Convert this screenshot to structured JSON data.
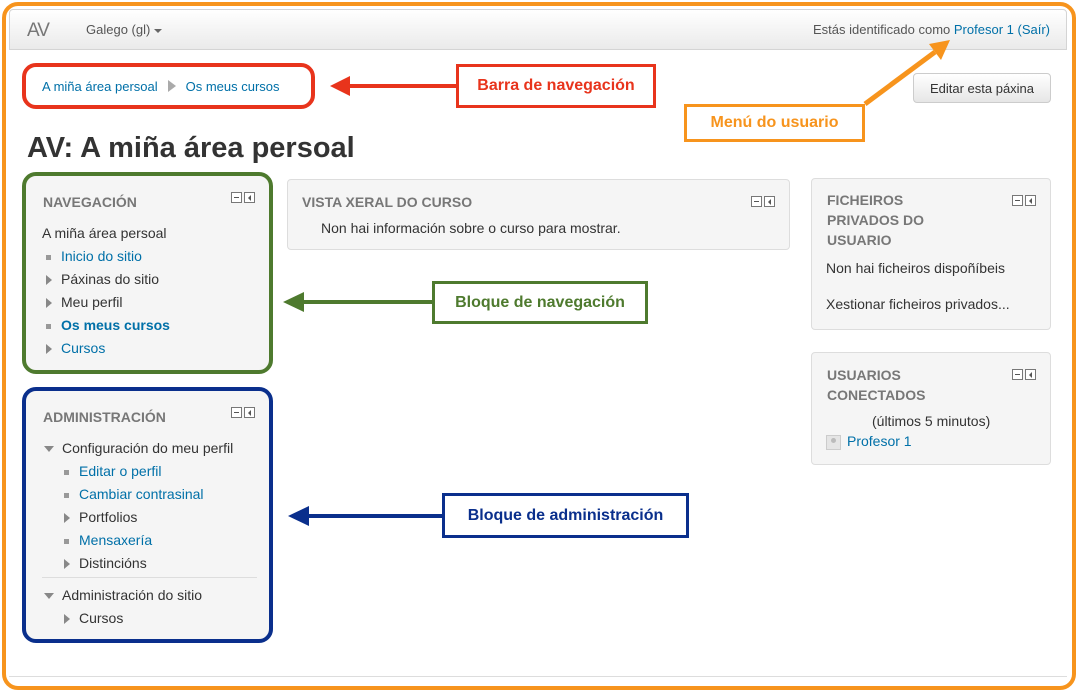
{
  "navbar": {
    "brand": "AV",
    "language": "Galego (gl)",
    "logged_in_prefix": "Estás identificado como",
    "user_name": "Profesor 1",
    "logout_label": "(Saír)"
  },
  "breadcrumb": {
    "items": [
      "A miña área persoal",
      "Os meus cursos"
    ]
  },
  "edit_button": "Editar esta páxina",
  "page_title": "AV: A miña área persoal",
  "navigation_block": {
    "title": "NAVEGACIÓN",
    "root": "A miña área persoal",
    "items": [
      "Inicio do sitio",
      "Páxinas do sitio",
      "Meu perfil",
      "Os meus cursos",
      "Cursos"
    ]
  },
  "admin_block": {
    "title": "ADMINISTRACIÓN",
    "profile_settings": "Configuración do meu perfil",
    "profile_items": [
      "Editar o perfil",
      "Cambiar contrasinal",
      "Portfolios",
      "Mensaxería",
      "Distincións"
    ],
    "site_admin": "Administración do sitio",
    "site_items": [
      "Cursos"
    ]
  },
  "course_overview": {
    "title": "VISTA XERAL DO CURSO",
    "message": "Non hai información sobre o curso para mostrar."
  },
  "private_files": {
    "title_lines": [
      "FICHEIROS",
      "PRIVADOS DO",
      "USUARIO"
    ],
    "message": "Non hai ficheiros dispoñíbeis",
    "manage_link": "Xestionar ficheiros privados..."
  },
  "online_users": {
    "title_lines": [
      "USUARIOS",
      "CONECTADOS"
    ],
    "period": "(últimos 5 minutos)",
    "users": [
      "Profesor 1"
    ]
  },
  "callouts": {
    "breadcrumb": "Barra de navegación",
    "user_menu": "Menú do usuario",
    "nav_block": "Bloque de navegación",
    "admin_block": "Bloque de administración"
  },
  "colors": {
    "frame": "#f7941d",
    "breadcrumb_callout": "#e8341c",
    "nav_callout": "#4e7a2e",
    "admin_callout": "#0a2f8c",
    "link": "#0070a8"
  }
}
